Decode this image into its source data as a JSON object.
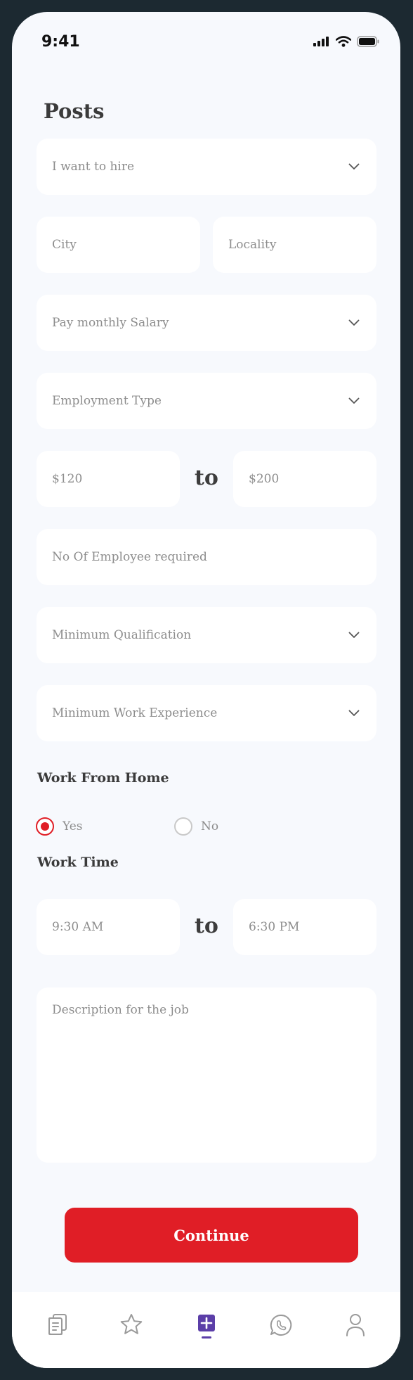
{
  "status_bar": {
    "time": "9:41"
  },
  "page": {
    "title": "Posts"
  },
  "form": {
    "hire": {
      "placeholder": "I want to hire"
    },
    "city": {
      "placeholder": "City"
    },
    "locality": {
      "placeholder": "Locality"
    },
    "pay": {
      "placeholder": "Pay monthly Salary"
    },
    "employment_type": {
      "placeholder": "Employment Type"
    },
    "salary_min": {
      "value": "$120"
    },
    "salary_to": "to",
    "salary_max": {
      "value": "$200"
    },
    "employees": {
      "placeholder": "No Of Employee required"
    },
    "qualification": {
      "placeholder": "Minimum Qualification"
    },
    "experience": {
      "placeholder": "Minimum Work Experience"
    },
    "work_from_home": {
      "label": "Work From Home",
      "options": [
        {
          "label": "Yes",
          "selected": true
        },
        {
          "label": "No",
          "selected": false
        }
      ]
    },
    "work_time": {
      "label": "Work Time",
      "start": "9:30 AM",
      "to": "to",
      "end": "6:30 PM"
    },
    "description": {
      "placeholder": "Description for the job"
    },
    "continue_label": "Continue"
  },
  "bottom_nav": {
    "items": [
      {
        "icon": "document-icon",
        "active": false
      },
      {
        "icon": "star-icon",
        "active": false
      },
      {
        "icon": "add-post-icon",
        "active": true
      },
      {
        "icon": "chat-icon",
        "active": false
      },
      {
        "icon": "profile-icon",
        "active": false
      }
    ]
  },
  "colors": {
    "accent": "#e01e26",
    "nav_active": "#5b3ea8",
    "background": "#f7f9fd"
  }
}
